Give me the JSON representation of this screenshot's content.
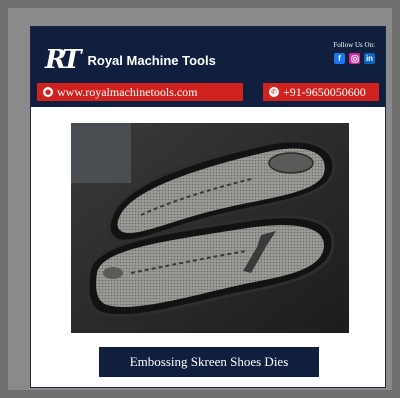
{
  "brand": {
    "logo_mark": "RT",
    "name": "Royal Machine Tools"
  },
  "follow": {
    "label": "Follow Us On:",
    "icons": [
      "facebook-icon",
      "instagram-icon",
      "linkedin-icon"
    ]
  },
  "contact": {
    "website": "www.royalmachinetools.com",
    "phone": "+91-9650050600"
  },
  "caption": "Embossing Skreen Shoes Dies",
  "colors": {
    "navy": "#0f1f3d",
    "red": "#d0231f",
    "facebook": "#1877f2",
    "instagram": "#d6249f",
    "linkedin": "#0a66c2"
  }
}
